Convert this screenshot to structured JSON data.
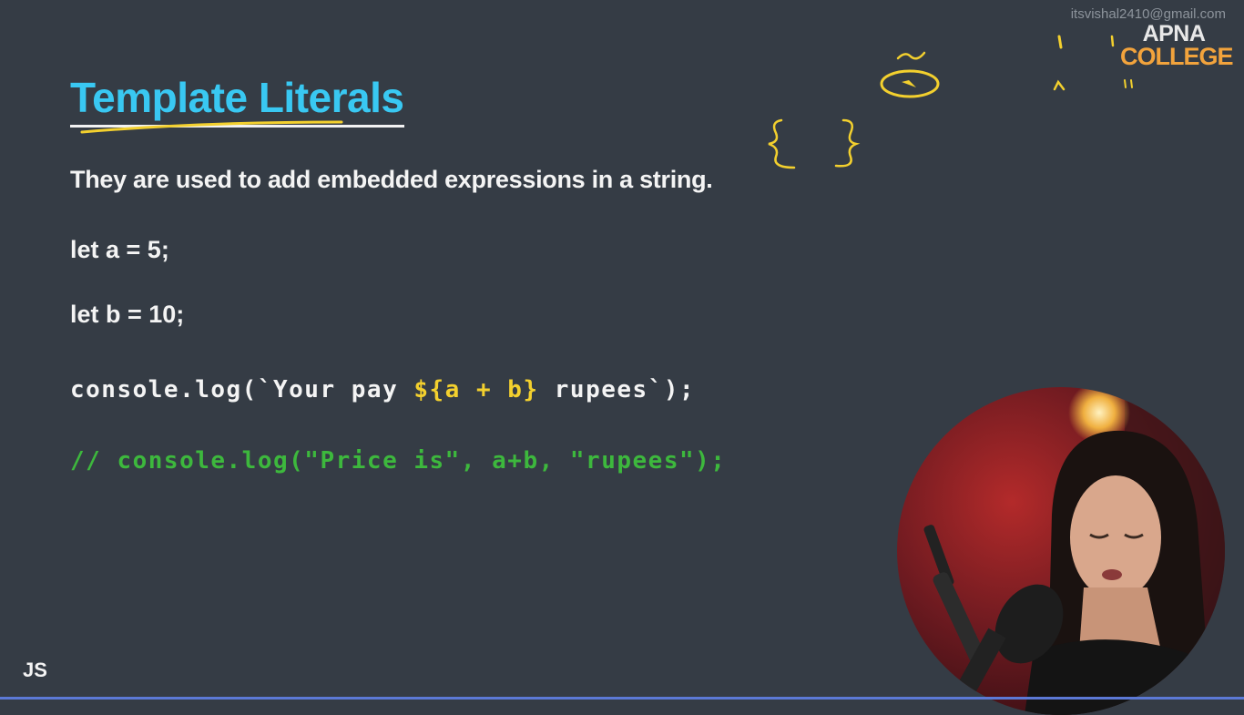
{
  "watermark": "itsvishal2410@gmail.com",
  "logo": {
    "line1": "APNA",
    "line2": "COLLEGE"
  },
  "slide": {
    "title": "Template Literals",
    "subtitle": "They are used to add embedded expressions in a string.",
    "code": {
      "line_a": "let a = 5;",
      "line_b": "let b = 10;",
      "log_before": "console.log(`Your pay ",
      "log_expr": "${a + b}",
      "log_after": " rupees`);",
      "comment": "// console.log(\"Price is\", a+b, \"rupees\");"
    },
    "footer_label": "JS"
  },
  "colors": {
    "background": "#353c45",
    "title": "#39c8f2",
    "highlight": "#f3d02e",
    "comment": "#3db83d",
    "logo_accent": "#f2a33c"
  }
}
